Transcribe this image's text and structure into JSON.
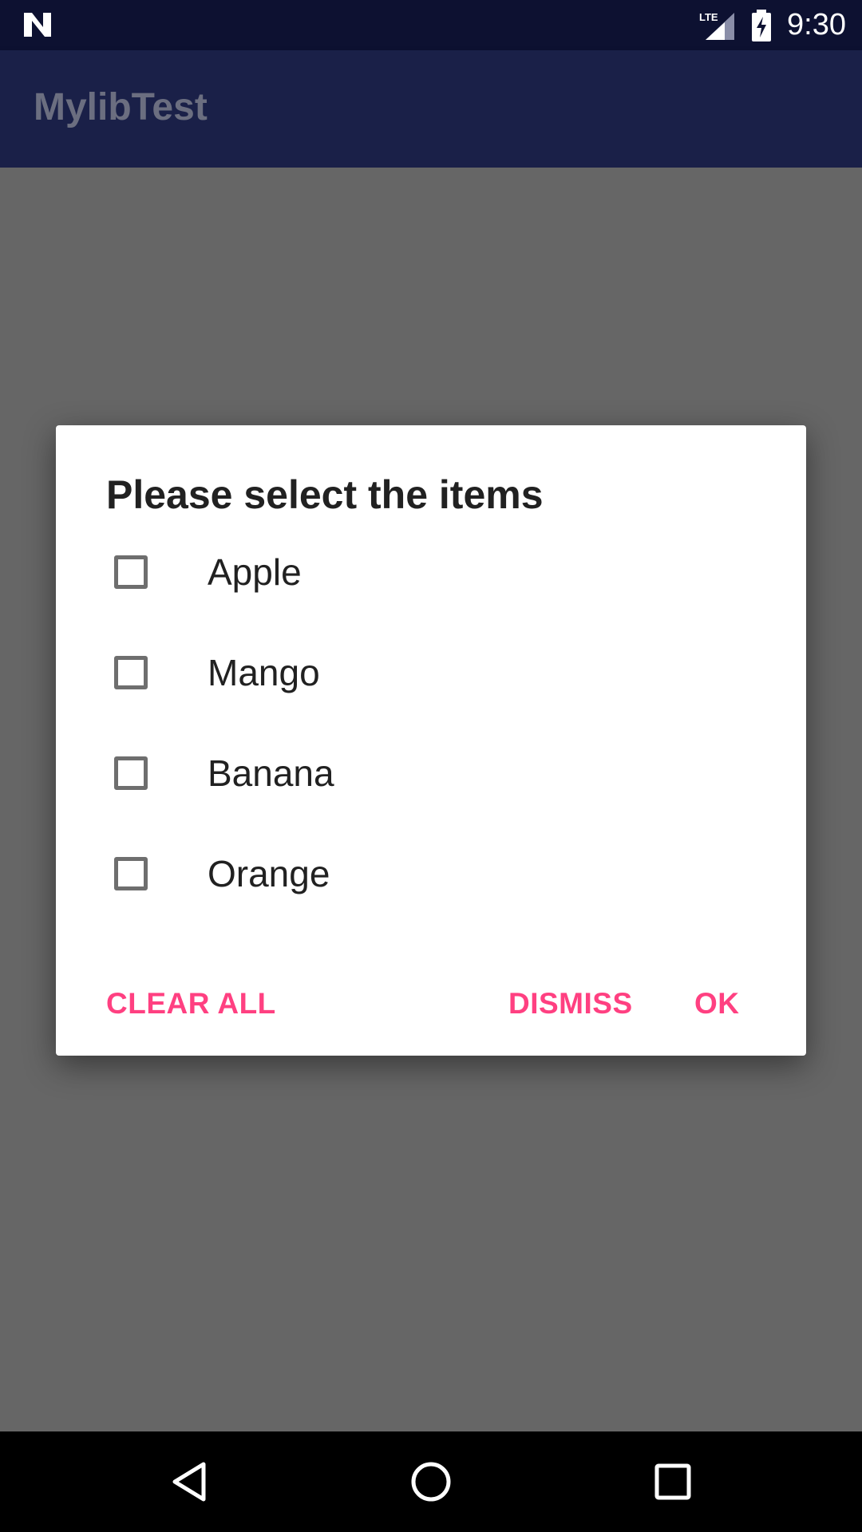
{
  "status_bar": {
    "time": "9:30",
    "network_label": "LTE",
    "icons": [
      "n-logo-icon",
      "lte-signal-icon",
      "battery-charging-icon"
    ]
  },
  "app_bar": {
    "title": "MylibTest"
  },
  "dialog": {
    "title": "Please select the items",
    "items": [
      {
        "label": "Apple",
        "checked": false
      },
      {
        "label": "Mango",
        "checked": false
      },
      {
        "label": "Banana",
        "checked": false
      },
      {
        "label": "Orange",
        "checked": false
      }
    ],
    "buttons": {
      "clear_all": "CLEAR ALL",
      "dismiss": "DISMISS",
      "ok": "OK"
    }
  },
  "nav_bar": {
    "icons": [
      "back-icon",
      "home-icon",
      "recents-icon"
    ]
  },
  "colors": {
    "accent": "#ff4081",
    "primary_dark": "#0d1131",
    "primary": "#1a2048",
    "scrim": "#666666"
  }
}
